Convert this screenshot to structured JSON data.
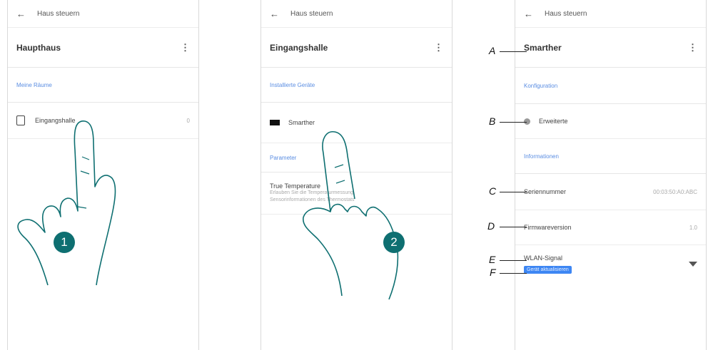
{
  "header_title": "Haus steuern",
  "screen1": {
    "home_name": "Haupthaus",
    "section": "Meine Räume",
    "room": "Eingangshalle",
    "room_count": "0",
    "step": "1"
  },
  "screen2": {
    "room_name": "Eingangshalle",
    "section_devices": "Installierte Geräte",
    "device": "Smarther",
    "section_params": "Parameter",
    "param_title": "True Temperature",
    "param_desc_1": "Erlauben Sie die Temperaturmessung",
    "param_desc_2": "Sensor­informationen des Thermostats",
    "step": "2"
  },
  "screen3": {
    "device_name": "Smarther",
    "section_config": "Konfiguration",
    "advanced": "Erweiterte",
    "section_info": "Informationen",
    "serial_label": "Seriennummer",
    "serial_value": "00:03:50:A0:ABC",
    "firmware_label": "Firmwareversion",
    "firmware_value": "1.0",
    "wlan_label": "WLAN-Signal",
    "wlan_status": "Gerät aktualisieren"
  },
  "callouts": [
    "A",
    "B",
    "C",
    "D",
    "E",
    "F"
  ]
}
